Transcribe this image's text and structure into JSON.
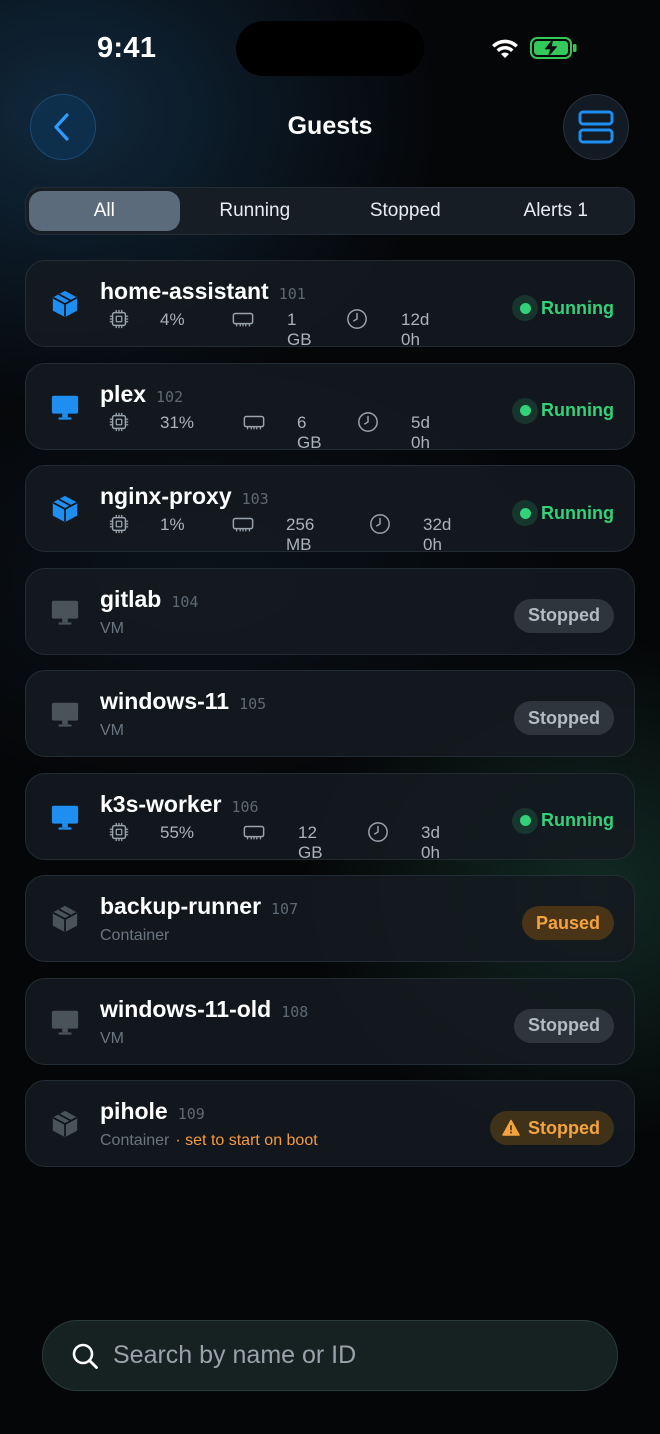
{
  "status_bar": {
    "time": "9:41",
    "wifi_icon": "wifi-icon",
    "battery_icon": "battery-charging-icon"
  },
  "header": {
    "title": "Guests",
    "back_icon": "chevron-left-icon",
    "layout_icon": "list-layout-icon"
  },
  "tabs": [
    {
      "label": "All",
      "active": true
    },
    {
      "label": "Running",
      "active": false
    },
    {
      "label": "Stopped",
      "active": false
    },
    {
      "label": "Alerts 1",
      "active": false
    }
  ],
  "guests": [
    {
      "name": "home-assistant",
      "id": "101",
      "icon": "container-icon",
      "cpu": "4%",
      "mem": "1 GB",
      "uptime": "12d 0h",
      "status": "Running"
    },
    {
      "name": "plex",
      "id": "102",
      "icon": "vm-monitor-icon",
      "cpu": "31%",
      "mem": "6 GB",
      "uptime": "5d 0h",
      "status": "Running"
    },
    {
      "name": "nginx-proxy",
      "id": "103",
      "icon": "container-icon",
      "cpu": "1%",
      "mem": "256 MB",
      "uptime": "32d 0h",
      "status": "Running"
    },
    {
      "name": "gitlab",
      "id": "104",
      "icon": "vm-monitor-icon",
      "type": "VM",
      "status": "Stopped"
    },
    {
      "name": "windows-11",
      "id": "105",
      "icon": "vm-monitor-icon",
      "type": "VM",
      "status": "Stopped"
    },
    {
      "name": "k3s-worker",
      "id": "106",
      "icon": "vm-monitor-icon",
      "cpu": "55%",
      "mem": "12 GB",
      "uptime": "3d 0h",
      "status": "Running"
    },
    {
      "name": "backup-runner",
      "id": "107",
      "icon": "container-icon",
      "type": "Container",
      "status": "Paused"
    },
    {
      "name": "windows-11-old",
      "id": "108",
      "icon": "vm-monitor-icon",
      "type": "VM",
      "status": "Stopped"
    },
    {
      "name": "pihole",
      "id": "109",
      "icon": "container-icon",
      "type": "Container",
      "note": "· set to start on boot",
      "status": "Stopped",
      "status_icon": "warning-icon"
    }
  ],
  "search": {
    "placeholder": "Search by name or ID",
    "icon": "search-icon"
  },
  "colors": {
    "running": "#33d17a",
    "accent_blue": "#1f8ef1",
    "warning": "#f5a33e",
    "muted": "#6b7580"
  }
}
